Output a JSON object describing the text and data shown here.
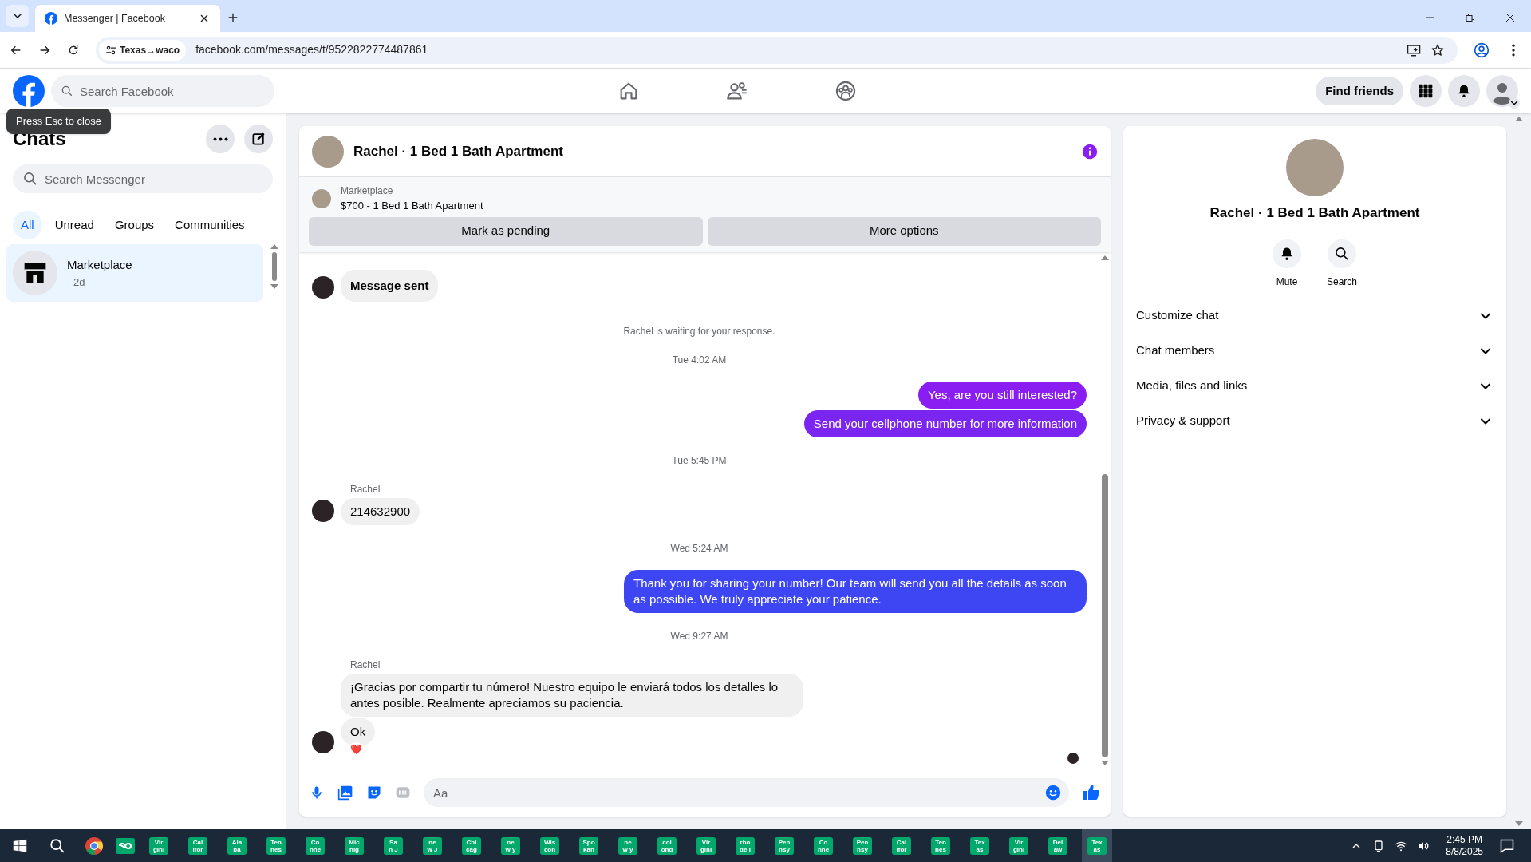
{
  "browser": {
    "tabs": [
      {
        "title": "Messenger | Facebook",
        "selected": true
      }
    ],
    "address": {
      "site_chip": "Texas→waco",
      "url": "facebook.com/messages/t/9522822774487861"
    }
  },
  "header": {
    "search": {
      "placeholder": "Search Facebook"
    },
    "nav": [
      {
        "selected": false
      },
      {
        "selected": false
      },
      {
        "selected": false
      }
    ],
    "find_friends": "Find friends"
  },
  "tooltip": "Press Esc to close",
  "sidebar": {
    "title": "Chats",
    "search": {
      "placeholder": "Search Messenger"
    },
    "filters": [
      {
        "label": "All",
        "selected": true
      },
      {
        "label": "Unread",
        "selected": false
      },
      {
        "label": "Groups",
        "selected": false
      },
      {
        "label": "Communities",
        "selected": false
      }
    ],
    "chats": [
      {
        "name": "Marketplace",
        "time": "· 2d",
        "selected": true
      }
    ]
  },
  "chat": {
    "title": "Rachel · 1 Bed 1 Bath Apartment",
    "listing": {
      "source": "Marketplace",
      "title": "$700 - 1 Bed 1 Bath Apartment",
      "actions": [
        "Mark as pending",
        "More options"
      ]
    },
    "messages": [
      {
        "kind": "incoming",
        "text": "Message sent",
        "bold": true,
        "avatar": true
      },
      {
        "kind": "system",
        "text": "Rachel is waiting for your response."
      },
      {
        "kind": "timestamp",
        "text": "Tue 4:02 AM"
      },
      {
        "kind": "outgoing",
        "text": "Yes, are you still interested?",
        "color": "#8a1ef2"
      },
      {
        "kind": "outgoing",
        "text": "Send your cellphone number for more information",
        "color": "#7b25f0"
      },
      {
        "kind": "timestamp",
        "text": "Tue 5:45 PM"
      },
      {
        "kind": "sender",
        "text": "Rachel"
      },
      {
        "kind": "incoming",
        "text": "214632900",
        "bold": false,
        "avatar": true
      },
      {
        "kind": "timestamp",
        "text": "Wed 5:24 AM"
      },
      {
        "kind": "outgoing",
        "text": "Thank you for sharing your number! Our team will send you all the details as soon as possible. We truly appreciate your patience.",
        "color": "#3d46f2"
      },
      {
        "kind": "timestamp",
        "text": "Wed 9:27 AM"
      },
      {
        "kind": "sender",
        "text": "Rachel"
      },
      {
        "kind": "incoming",
        "text": "¡Gracias por compartir tu número! Nuestro equipo le enviará todos los detalles lo antes posible. Realmente apreciamos su paciencia.",
        "bold": false,
        "avatar": false
      },
      {
        "kind": "incoming",
        "text": "Ok",
        "bold": false,
        "avatar": true,
        "reaction": "❤️"
      }
    ],
    "composer": {
      "placeholder": "Aa"
    }
  },
  "details": {
    "name": "Rachel · 1 Bed 1 Bath Apartment",
    "actions": [
      "Mute",
      "Search"
    ],
    "sections": [
      "Customize chat",
      "Chat members",
      "Media, files and links",
      "Privacy & support"
    ]
  },
  "taskbar": {
    "apps": [
      {
        "lines": [
          "Vir",
          "gini"
        ],
        "selected": false
      },
      {
        "lines": [
          "Cal",
          "ifor"
        ],
        "selected": false
      },
      {
        "lines": [
          "Ala",
          "ba"
        ],
        "selected": false
      },
      {
        "lines": [
          "Ten",
          "nes"
        ],
        "selected": false
      },
      {
        "lines": [
          "Co",
          "nne"
        ],
        "selected": false
      },
      {
        "lines": [
          "Mic",
          "hig"
        ],
        "selected": false
      },
      {
        "lines": [
          "Sa",
          "n J"
        ],
        "selected": false
      },
      {
        "lines": [
          "ne",
          "w J"
        ],
        "selected": false
      },
      {
        "lines": [
          "Chi",
          "cag"
        ],
        "selected": false
      },
      {
        "lines": [
          "ne",
          "w y"
        ],
        "selected": false
      },
      {
        "lines": [
          "Wis",
          "con"
        ],
        "selected": false
      },
      {
        "lines": [
          "Spo",
          "kan"
        ],
        "selected": false
      },
      {
        "lines": [
          "ne",
          "w y"
        ],
        "selected": false
      },
      {
        "lines": [
          "col",
          "ond"
        ],
        "selected": false
      },
      {
        "lines": [
          "Vir",
          "gini"
        ],
        "selected": false
      },
      {
        "lines": [
          "rho",
          "de I"
        ],
        "selected": false
      },
      {
        "lines": [
          "Pen",
          "nsy"
        ],
        "selected": false
      },
      {
        "lines": [
          "Co",
          "nne"
        ],
        "selected": false
      },
      {
        "lines": [
          "Pen",
          "nsy"
        ],
        "selected": false
      },
      {
        "lines": [
          "Cal",
          "ifor"
        ],
        "selected": false
      },
      {
        "lines": [
          "Ten",
          "nes"
        ],
        "selected": false
      },
      {
        "lines": [
          "Tex",
          "as"
        ],
        "selected": false
      },
      {
        "lines": [
          "Vir",
          "gini"
        ],
        "selected": false
      },
      {
        "lines": [
          "Del",
          "aw"
        ],
        "selected": false
      },
      {
        "lines": [
          "Tex",
          "as"
        ],
        "selected": true
      }
    ],
    "time": "2:45 PM",
    "date": "8/8/2025"
  }
}
